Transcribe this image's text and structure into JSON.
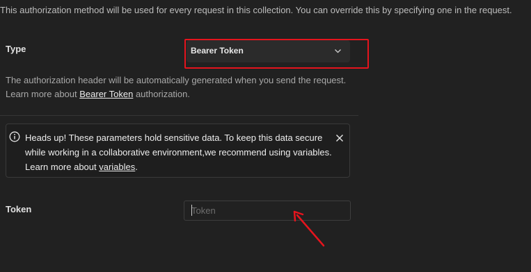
{
  "description": "This authorization method will be used for every request in this collection. You can override this by specifying one in the request.",
  "type_field": {
    "label": "Type",
    "selected": "Bearer Token",
    "highlight_color": "#e5141d"
  },
  "auth_info": {
    "line1": "The authorization header will be automatically generated when you send the request.",
    "line2_prefix": "Learn more about ",
    "line2_link": "Bearer Token",
    "line2_suffix": " authorization."
  },
  "warning": {
    "text": "Heads up! These parameters hold sensitive data. To keep this data secure while working in a collaborative environment,we recommend using variables.",
    "learn_prefix": "Learn more about ",
    "learn_link": "variables",
    "learn_suffix": "."
  },
  "token_field": {
    "label": "Token",
    "placeholder": "Token",
    "value": ""
  },
  "annotation_color": "#e5141d"
}
